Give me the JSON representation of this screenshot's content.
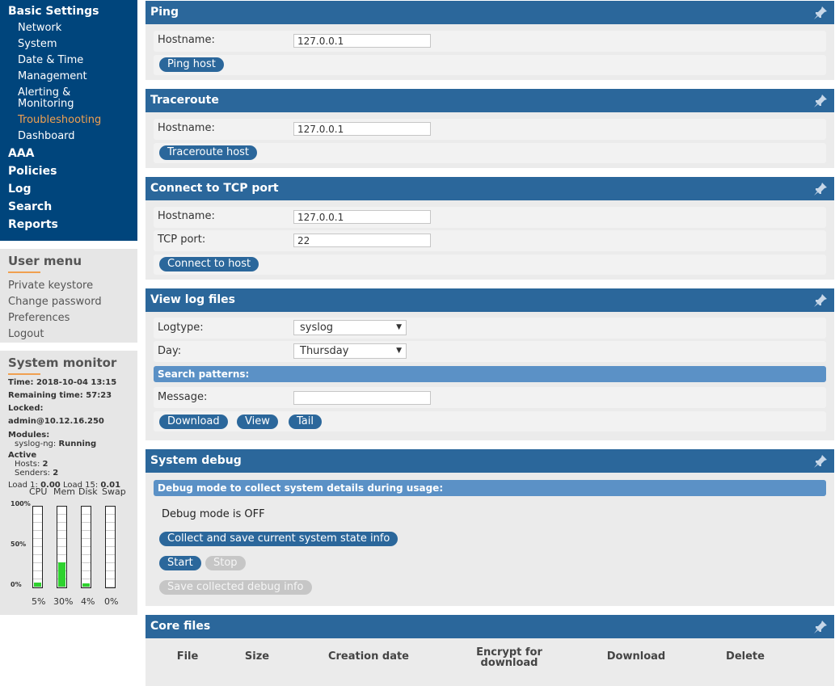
{
  "nav": {
    "basic_settings": "Basic Settings",
    "sub_items": [
      "Network",
      "System",
      "Date & Time",
      "Management",
      "Alerting & Monitoring",
      "Troubleshooting",
      "Dashboard"
    ],
    "active": "Troubleshooting",
    "top_items": [
      "AAA",
      "Policies",
      "Log",
      "Search",
      "Reports"
    ]
  },
  "user_menu": {
    "title": "User menu",
    "items": [
      "Private keystore",
      "Change password",
      "Preferences",
      "Logout"
    ]
  },
  "system_monitor": {
    "title": "System monitor",
    "time_label": "Time:",
    "time": "2018-10-04 13:15",
    "remaining_label": "Remaining time:",
    "remaining": "57:23",
    "locked_label": "Locked:",
    "locked": "admin@10.12.16.250",
    "modules_label": "Modules:",
    "module_name": "syslog-ng:",
    "module_status": "Running",
    "active_label": "Active",
    "hosts_label": "Hosts:",
    "hosts": "2",
    "senders_label": "Senders:",
    "senders": "2",
    "load1_label": "Load 1:",
    "load1": "0.00",
    "load15_label": "Load 15:",
    "load15": "0.01",
    "axis": [
      "100%",
      "50%",
      "0%"
    ],
    "gauges": [
      {
        "label": "CPU",
        "pct_text": "5%",
        "value": 5
      },
      {
        "label": "Mem",
        "pct_text": "30%",
        "value": 30
      },
      {
        "label": "Disk",
        "pct_text": "4%",
        "value": 4
      },
      {
        "label": "Swap",
        "pct_text": "0%",
        "value": 0
      }
    ],
    "fill_color": "#2ed22e"
  },
  "ping": {
    "title": "Ping",
    "hostname_label": "Hostname:",
    "hostname": "127.0.0.1",
    "button": "Ping host"
  },
  "traceroute": {
    "title": "Traceroute",
    "hostname_label": "Hostname:",
    "hostname": "127.0.0.1",
    "button": "Traceroute host"
  },
  "tcp": {
    "title": "Connect to TCP port",
    "hostname_label": "Hostname:",
    "hostname": "127.0.0.1",
    "port_label": "TCP port:",
    "port": "22",
    "button": "Connect to host"
  },
  "logs": {
    "title": "View log files",
    "logtype_label": "Logtype:",
    "logtype": "syslog",
    "day_label": "Day:",
    "day": "Thursday",
    "search_patterns": "Search patterns:",
    "message_label": "Message:",
    "message": "",
    "buttons": [
      "Download",
      "View",
      "Tail"
    ]
  },
  "debug": {
    "title": "System debug",
    "subhead": "Debug mode to collect system details during usage:",
    "status": "Debug mode is OFF",
    "collect_button": "Collect and save current system state info",
    "start_button": "Start",
    "stop_button": "Stop",
    "save_button": "Save collected debug info"
  },
  "core": {
    "title": "Core files",
    "columns": [
      "File",
      "Size",
      "Creation date",
      "Encrypt for\ndownload",
      "Download",
      "Delete"
    ]
  },
  "colors": {
    "nav_bg": "#00457c",
    "header_bg": "#2b679b",
    "subhead_bg": "#5b91c6",
    "active_nav": "#f0a050"
  }
}
